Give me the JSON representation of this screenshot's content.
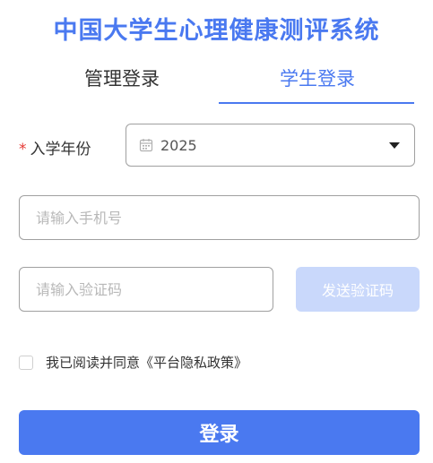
{
  "app": {
    "title": "中国大学生心理健康测评系统"
  },
  "tabs": [
    {
      "label": "管理登录",
      "active": false
    },
    {
      "label": "学生登录",
      "active": true
    }
  ],
  "enrollment_year": {
    "required_mark": "*",
    "label": "入学年份",
    "value": "2025"
  },
  "phone": {
    "placeholder": "请输入手机号"
  },
  "verification": {
    "placeholder": "请输入验证码",
    "send_button": "发送验证码"
  },
  "agreement": {
    "checked": false,
    "text": "我已阅读并同意《平台隐私政策》"
  },
  "login_button": "登录",
  "colors": {
    "accent": "#4a79f0",
    "accent_light": "#c9d8fb",
    "required": "#e53935"
  },
  "icons": {
    "year_field": "calendar-icon",
    "dropdown": "caret-down-icon"
  }
}
